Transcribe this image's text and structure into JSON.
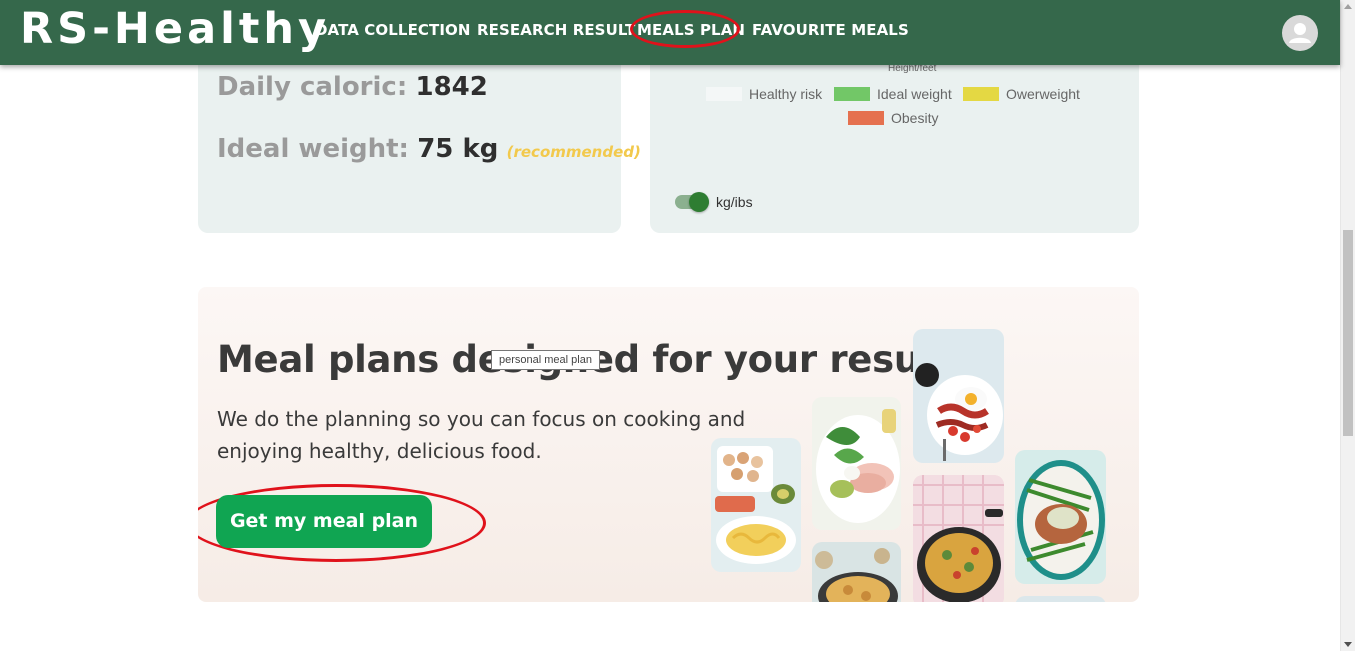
{
  "app": {
    "logo": "RS-Healthy"
  },
  "nav": {
    "items": [
      {
        "label": "DATA COLLECTION"
      },
      {
        "label": "RESEARCH RESULT"
      },
      {
        "label": "MEALS PLAN",
        "highlighted": true
      },
      {
        "label": "FAVOURITE MEALS"
      }
    ],
    "avatar_icon": "user-avatar-icon"
  },
  "stats": {
    "daily_caloric_label": "Daily caloric:",
    "daily_caloric_value": "1842",
    "ideal_weight_label": "Ideal weight:",
    "ideal_weight_value": "75 kg",
    "ideal_weight_note": "(recommended)"
  },
  "chart": {
    "axis_label": "Height/feet",
    "legend": [
      {
        "label": "Healthy risk",
        "color": "#f4f7f7"
      },
      {
        "label": "Ideal weight",
        "color": "#72c767"
      },
      {
        "label": "Owerweight",
        "color": "#e4d843"
      },
      {
        "label": "Obesity",
        "color": "#e5714f"
      }
    ],
    "unit_toggle": {
      "label": "kg/ibs",
      "on": true
    }
  },
  "promo": {
    "title": "Meal plans designed for your results",
    "description": "We do the planning so you can focus on cooking and enjoying healthy, delicious food.",
    "cta_label": "Get my meal plan",
    "tooltip": "personal meal plan"
  },
  "colors": {
    "nav_bg": "#35684b",
    "card_bg": "#eaf1f0",
    "cta_bg": "#10a552",
    "annotation_red": "#e0121b",
    "note_yellow": "#f2c94c"
  }
}
